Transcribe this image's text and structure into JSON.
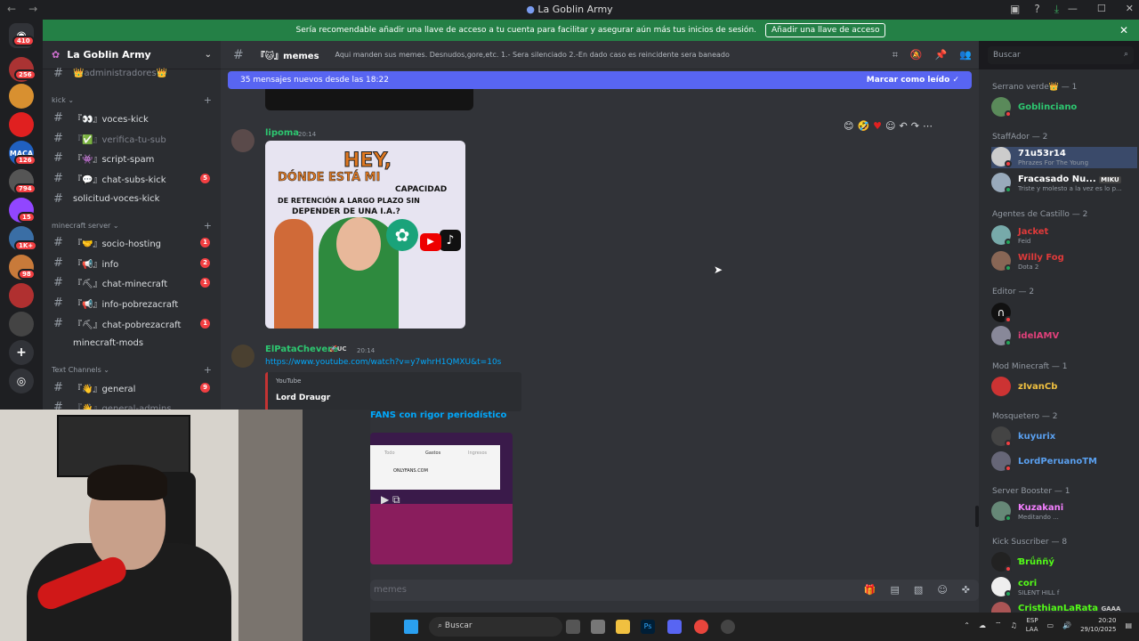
{
  "window": {
    "title": "La Goblin Army"
  },
  "banner": {
    "text": "Sería recomendable añadir una llave de acceso a tu cuenta para facilitar y asegurar aún más tus inicios de sesión.",
    "button": "Añadir una llave de acceso"
  },
  "guild_badges": [
    "410",
    "256",
    "126",
    "794",
    "15",
    "1K+",
    "98"
  ],
  "server": {
    "name": "La Goblin Army"
  },
  "channels": {
    "top_item": "👑administradores👑",
    "categories": {
      "kick": "kick",
      "minecraft": "minecraft server",
      "text": "Text Channels"
    },
    "items": [
      {
        "name": "『👀』voces-kick",
        "badge": ""
      },
      {
        "name": "『✅』verifica-tu-sub",
        "badge": ""
      },
      {
        "name": "『👾』script-spam",
        "badge": ""
      },
      {
        "name": "『💬』chat-subs-kick",
        "badge": "5"
      },
      {
        "name": "solicitud-voces-kick",
        "badge": ""
      },
      {
        "name": "『🤝』socio-hosting",
        "badge": "1"
      },
      {
        "name": "『📢』info",
        "badge": "2"
      },
      {
        "name": "『⛏』chat-minecraft",
        "badge": "1"
      },
      {
        "name": "『📢』info-pobrezacraft",
        "badge": ""
      },
      {
        "name": "『⛏』chat-pobrezacraft",
        "badge": "1"
      },
      {
        "name": "minecraft-mods",
        "badge": ""
      },
      {
        "name": "『👋』general",
        "badge": "9"
      },
      {
        "name": "『👋』general-admins",
        "badge": ""
      }
    ]
  },
  "header": {
    "channel": "『🐱』memes",
    "topic": "Aqui manden sus memes. Desnudos,gore,etc. 1.- Sera silenciado 2.-En dado caso es reincidente sera baneado",
    "search_placeholder": "Buscar"
  },
  "new_messages": {
    "text": "35 mensajes nuevos desde las 18:22",
    "mark_read": "Marcar como leído"
  },
  "messages": [
    {
      "author": "lipoma",
      "time": "20:14",
      "image_text": {
        "top": "HEY,",
        "mid": "DÓNDE ESTÁ MI",
        "line1": "CAPACIDAD",
        "line2": "DE RETENCIÓN A LARGO PLAZO SIN",
        "line3": "DEPENDER DE UNA I.A.?"
      }
    },
    {
      "author": "ElPataChevere",
      "tag": "UC",
      "time": "20:14",
      "link": "https://www.youtube.com/watch?v=y7whrH1QMXU&t=10s",
      "embed": {
        "provider": "YouTube",
        "author": "Lord Draugr",
        "title": "FANS con rigor periodístico",
        "tabs": [
          "Todo",
          "Gastos",
          "Ingresos"
        ],
        "row": "ONLYFANS.COM"
      }
    }
  ],
  "input": {
    "placeholder": "memes"
  },
  "members": {
    "groups": [
      {
        "title": "Serrano verde👑 — 1",
        "members": [
          {
            "name": "Goblinciano",
            "activity": "",
            "color": "#2dc770"
          }
        ]
      },
      {
        "title": "StaffAdor — 2",
        "members": [
          {
            "name": "71u53r14",
            "activity": "Phrazes For The Young",
            "color": "#ffffff"
          },
          {
            "name": "Fracasado Nu...",
            "activity": "Triste y molesto a la vez es lo p...",
            "color": "#ffffff",
            "tag": "MIKU"
          }
        ]
      },
      {
        "title": "Agentes de Castillo — 2",
        "members": [
          {
            "name": "Jacket",
            "activity": "Feid",
            "color": "#e03a3a"
          },
          {
            "name": "Willy Fog",
            "activity": "Dota 2",
            "color": "#e03a3a"
          }
        ]
      },
      {
        "title": "Editor — 2",
        "members": [
          {
            "name": "",
            "activity": "",
            "color": "#ffffff"
          },
          {
            "name": "idelAMV",
            "activity": "",
            "color": "#e0407a"
          }
        ]
      },
      {
        "title": "Mod Minecraft — 1",
        "members": [
          {
            "name": "zIvanCb",
            "activity": "",
            "color": "#f0c040"
          }
        ]
      },
      {
        "title": "Mosquetero — 2",
        "members": [
          {
            "name": "kuyurix",
            "activity": "",
            "color": "#5aa0f0"
          },
          {
            "name": "LordPeruanoTM",
            "activity": "",
            "color": "#5aa0f0"
          }
        ]
      },
      {
        "title": "Server Booster — 1",
        "members": [
          {
            "name": "Kuzakani",
            "activity": "Meditando ...",
            "color": "#f47fff"
          }
        ]
      },
      {
        "title": "Kick Suscriber — 8",
        "members": [
          {
            "name": "Ɓrǘññý",
            "activity": "",
            "color": "#53fc18"
          },
          {
            "name": "cori",
            "activity": "SILENT HILL f",
            "color": "#53fc18"
          },
          {
            "name": "CristhianLaRata",
            "activity": "",
            "color": "#53fc18",
            "tag": "GAAA"
          }
        ]
      }
    ]
  },
  "taskbar": {
    "search": "Buscar",
    "lang": "ESP",
    "lang2": "LAA",
    "time": "20:20",
    "date": "29/10/2025"
  }
}
